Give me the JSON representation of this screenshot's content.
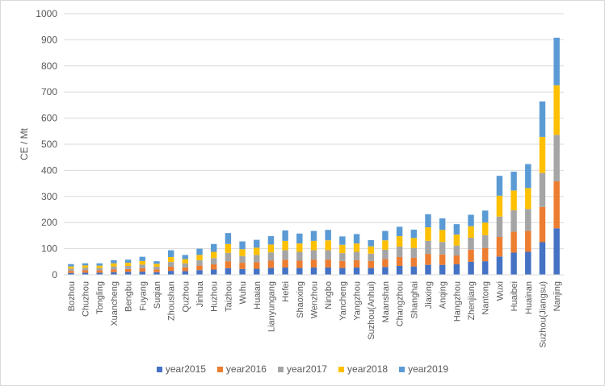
{
  "chart_data": {
    "type": "bar",
    "stacked": true,
    "title": "",
    "xlabel": "",
    "ylabel": "CE / Mt",
    "ylim": [
      0,
      1000
    ],
    "yticks": [
      0,
      100,
      200,
      300,
      400,
      500,
      600,
      700,
      800,
      900,
      1000
    ],
    "grid": true,
    "legend_position": "bottom",
    "categories": [
      "Bozhou",
      "Chuzhou",
      "Tongling",
      "Xuancheng",
      "Bengbu",
      "Fuyang",
      "Suqian",
      "Zhoushan",
      "Quzhou",
      "Jinhua",
      "Huzhou",
      "Taizhou",
      "Wuhu",
      "Huaian",
      "Lianyungang",
      "Hefei",
      "Shaoxing",
      "Wenzhou",
      "Ningbo",
      "Yancheng",
      "Yangzhou",
      "Suzhou(Anhui)",
      "Maanshan",
      "Changzhou",
      "Shanghai",
      "Jiaxing",
      "Anqing",
      "Hangzhou",
      "Zhenjiang",
      "Nantong",
      "Wuxi",
      "Huaibei",
      "Huainan",
      "Suzhou(Jiangsu)",
      "Nanjing"
    ],
    "series": [
      {
        "name": "year2015",
        "color": "#4472c4",
        "values": [
          7,
          8,
          8,
          10,
          11,
          12,
          10,
          15,
          14,
          18,
          20,
          25,
          22,
          23,
          26,
          28,
          26,
          28,
          28,
          26,
          28,
          26,
          30,
          34,
          32,
          38,
          38,
          40,
          50,
          52,
          70,
          85,
          88,
          125,
          178
        ]
      },
      {
        "name": "year2016",
        "color": "#ed7d31",
        "values": [
          8,
          9,
          9,
          10,
          11,
          13,
          10,
          16,
          14,
          18,
          20,
          27,
          24,
          25,
          28,
          30,
          28,
          30,
          30,
          27,
          28,
          27,
          30,
          34,
          33,
          42,
          40,
          34,
          46,
          50,
          75,
          80,
          80,
          135,
          180
        ]
      },
      {
        "name": "year2017",
        "color": "#a5a5a5",
        "values": [
          9,
          10,
          9,
          12,
          12,
          14,
          11,
          18,
          16,
          20,
          24,
          32,
          26,
          28,
          32,
          36,
          34,
          36,
          36,
          30,
          32,
          28,
          36,
          40,
          38,
          50,
          48,
          38,
          46,
          50,
          78,
          82,
          84,
          130,
          178
        ]
      },
      {
        "name": "year2018",
        "color": "#ffc000",
        "values": [
          8,
          9,
          9,
          12,
          12,
          14,
          11,
          19,
          16,
          20,
          24,
          34,
          26,
          28,
          30,
          36,
          32,
          36,
          38,
          32,
          32,
          28,
          36,
          40,
          38,
          52,
          46,
          42,
          44,
          48,
          80,
          76,
          80,
          138,
          190
        ]
      },
      {
        "name": "year2019",
        "color": "#5b9bd5",
        "values": [
          9,
          8,
          9,
          12,
          12,
          16,
          10,
          26,
          16,
          24,
          30,
          42,
          30,
          30,
          32,
          40,
          38,
          38,
          40,
          32,
          36,
          24,
          36,
          36,
          32,
          50,
          44,
          40,
          44,
          46,
          76,
          72,
          92,
          136,
          182
        ]
      }
    ]
  }
}
